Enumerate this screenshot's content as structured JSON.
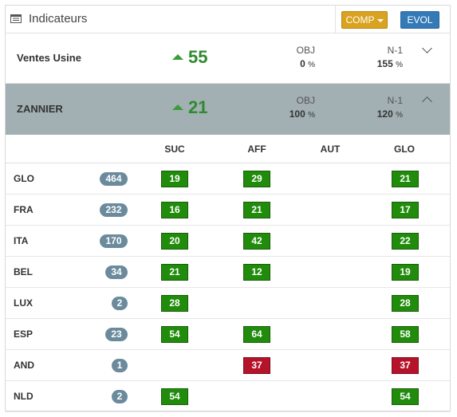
{
  "header": {
    "title": "Indicateurs",
    "comp_label": "COMP",
    "evol_label": "EVOL"
  },
  "groups": [
    {
      "name": "Ventes Usine",
      "value": "55",
      "trend": "up",
      "obj_label": "OBJ",
      "obj_value": "0",
      "n1_label": "N-1",
      "n1_value": "155",
      "pct": "%",
      "expanded": false
    },
    {
      "name": "ZANNIER",
      "value": "21",
      "trend": "up",
      "obj_label": "OBJ",
      "obj_value": "100",
      "n1_label": "N-1",
      "n1_value": "120",
      "pct": "%",
      "expanded": true
    }
  ],
  "columns": [
    "SUC",
    "AFF",
    "AUT",
    "GLO"
  ],
  "rows": [
    {
      "code": "GLO",
      "count": "464",
      "SUC": "19",
      "AFF": "29",
      "AUT": "",
      "GLO": "21"
    },
    {
      "code": "FRA",
      "count": "232",
      "SUC": "16",
      "AFF": "21",
      "AUT": "",
      "GLO": "17"
    },
    {
      "code": "ITA",
      "count": "170",
      "SUC": "20",
      "AFF": "42",
      "AUT": "",
      "GLO": "22"
    },
    {
      "code": "BEL",
      "count": "34",
      "SUC": "21",
      "AFF": "12",
      "AUT": "",
      "GLO": "19"
    },
    {
      "code": "LUX",
      "count": "2",
      "SUC": "28",
      "AFF": "",
      "AUT": "",
      "GLO": "28"
    },
    {
      "code": "ESP",
      "count": "23",
      "SUC": "54",
      "AFF": "64",
      "AUT": "",
      "GLO": "58"
    },
    {
      "code": "AND",
      "count": "1",
      "SUC": "",
      "AFF": "37",
      "AUT": "",
      "GLO": "37"
    },
    {
      "code": "NLD",
      "count": "2",
      "SUC": "54",
      "AFF": "",
      "AUT": "",
      "GLO": "54"
    }
  ],
  "cell_status": {
    "AND.AFF": "bad",
    "AND.GLO": "bad"
  },
  "colors": {
    "ok": "#218b0c",
    "bad": "#b5132a",
    "badge": "#6b8b9c",
    "trend_up": "#3a9d3a"
  }
}
